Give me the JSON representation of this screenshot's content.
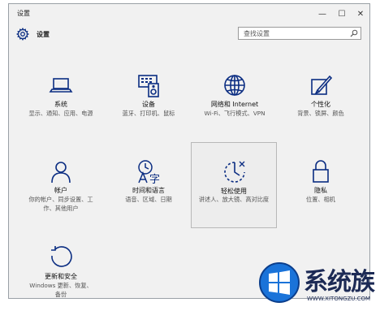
{
  "window": {
    "title": "设置",
    "minimize_glyph": "—",
    "maximize_glyph": "☐",
    "close_glyph": "✕"
  },
  "header": {
    "title": "设置",
    "icon": "gear-icon"
  },
  "search": {
    "placeholder": "查找设置",
    "icon": "search-icon"
  },
  "tiles": [
    {
      "name": "系统",
      "desc": "显示、通知、应用、电源",
      "icon": "laptop-icon"
    },
    {
      "name": "设备",
      "desc": "蓝牙、打印机、鼠标",
      "icon": "devices-icon"
    },
    {
      "name": "网络和 Internet",
      "desc": "Wi-Fi、飞行模式、VPN",
      "icon": "globe-icon"
    },
    {
      "name": "个性化",
      "desc": "背景、锁屏、颜色",
      "icon": "personalization-icon"
    },
    {
      "name": "帐户",
      "desc": "你的帐户、同步设置、工作、其他用户",
      "icon": "user-icon"
    },
    {
      "name": "时间和语言",
      "desc": "语音、区域、日期",
      "icon": "time-language-icon"
    },
    {
      "name": "轻松使用",
      "desc": "讲述人、放大镜、高对比度",
      "icon": "ease-of-access-icon"
    },
    {
      "name": "隐私",
      "desc": "位置、相机",
      "icon": "lock-icon"
    },
    {
      "name": "更新和安全",
      "desc": "Windows 更新、恢复、备份",
      "icon": "update-icon"
    }
  ],
  "watermark": {
    "text": "系统族",
    "url": "WWW.XITONGZU.COM"
  },
  "colors": {
    "icon": "#0b2d82",
    "window_bg": "#f1f1f1",
    "watermark_blue": "#1c2a55",
    "logo_blue": "#1a73d9"
  }
}
